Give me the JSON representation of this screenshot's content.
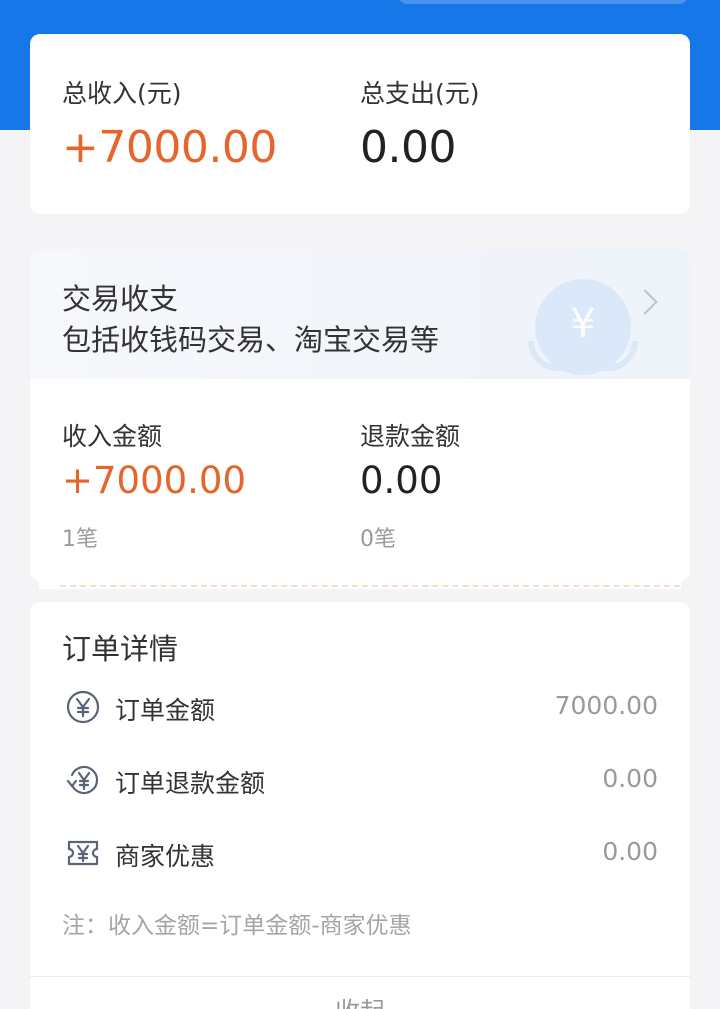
{
  "summary": {
    "income_label": "总收入(元)",
    "income_value": "+7000.00",
    "expense_label": "总支出(元)",
    "expense_value": "0.00"
  },
  "trade": {
    "title": "交易收支",
    "subtitle": "包括收钱码交易、淘宝交易等",
    "coin_glyph": "¥",
    "income_label": "收入金额",
    "income_value": "+7000.00",
    "income_count": "1笔",
    "refund_label": "退款金额",
    "refund_value": "0.00",
    "refund_count": "0笔"
  },
  "order": {
    "title": "订单详情",
    "rows": [
      {
        "icon": "yen-circle-icon",
        "label": "订单金额",
        "value": "7000.00"
      },
      {
        "icon": "yen-refund-icon",
        "label": "订单退款金额",
        "value": "0.00"
      },
      {
        "icon": "yen-ticket-icon",
        "label": "商家优惠",
        "value": "0.00"
      }
    ],
    "note": "注：收入金额=订单金额-商家优惠",
    "collapse_label": "收起"
  },
  "colors": {
    "accent_blue": "#1677e8",
    "income_orange": "#e5652a",
    "icon_gray": "#5a6478"
  }
}
